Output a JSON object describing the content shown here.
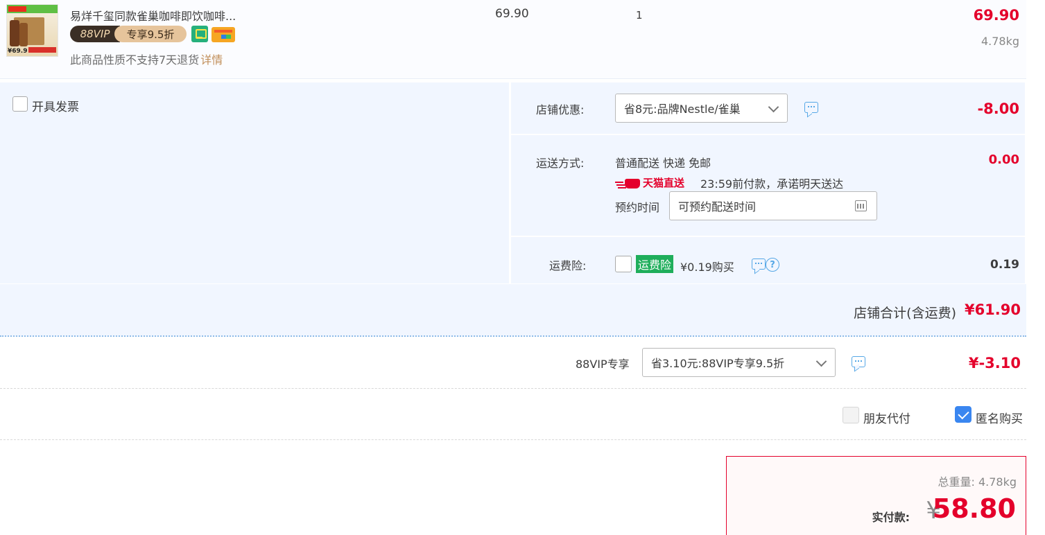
{
  "product": {
    "title": "易烊千玺同款雀巢咖啡即饮咖啡...",
    "vip_badge_left": "88VIP",
    "vip_badge_right": "专享9.5折",
    "thumb_price": "¥69.9",
    "return_notice": "此商品性质不支持7天退货",
    "return_link": "详情",
    "unit_price": "69.90",
    "quantity": "1",
    "subtotal": "69.90",
    "weight": "4.78kg"
  },
  "invoice": {
    "label": "开具发票",
    "checked": false
  },
  "shop_discount": {
    "label": "店铺优惠:",
    "selected": "省8元:品牌Nestle/雀巢",
    "amount": "-8.00"
  },
  "shipping": {
    "label": "运送方式:",
    "method": "普通配送 快递 免邮",
    "badge": "天猫直送",
    "promise": "23:59前付款，承诺明天送达",
    "appointment_label": "预约时间",
    "appointment_value": "可预约配送时间",
    "amount": "0.00"
  },
  "insurance": {
    "label": "运费险:",
    "tag": "运费险",
    "price": "¥0.19购买",
    "amount": "0.19",
    "checked": false
  },
  "shop_total": {
    "label": "店铺合计(含运费)",
    "amount": "¥61.90"
  },
  "vip_discount": {
    "label": "88VIP专享",
    "selected": "省3.10元:88VIP专享9.5折",
    "amount": "¥-3.10"
  },
  "pay_options": {
    "friend_pay": "朋友代付",
    "friend_pay_checked": false,
    "anonymous": "匿名购买",
    "anonymous_checked": true
  },
  "summary": {
    "total_weight": "总重量: 4.78kg",
    "pay_label": "实付款:",
    "currency": "¥",
    "amount": "58.80"
  },
  "colors": {
    "price_red": "#e4002b",
    "panel_bg": "#f1f6ff",
    "accent_blue": "#3a86f0",
    "insurance_green": "#1fae5b"
  }
}
